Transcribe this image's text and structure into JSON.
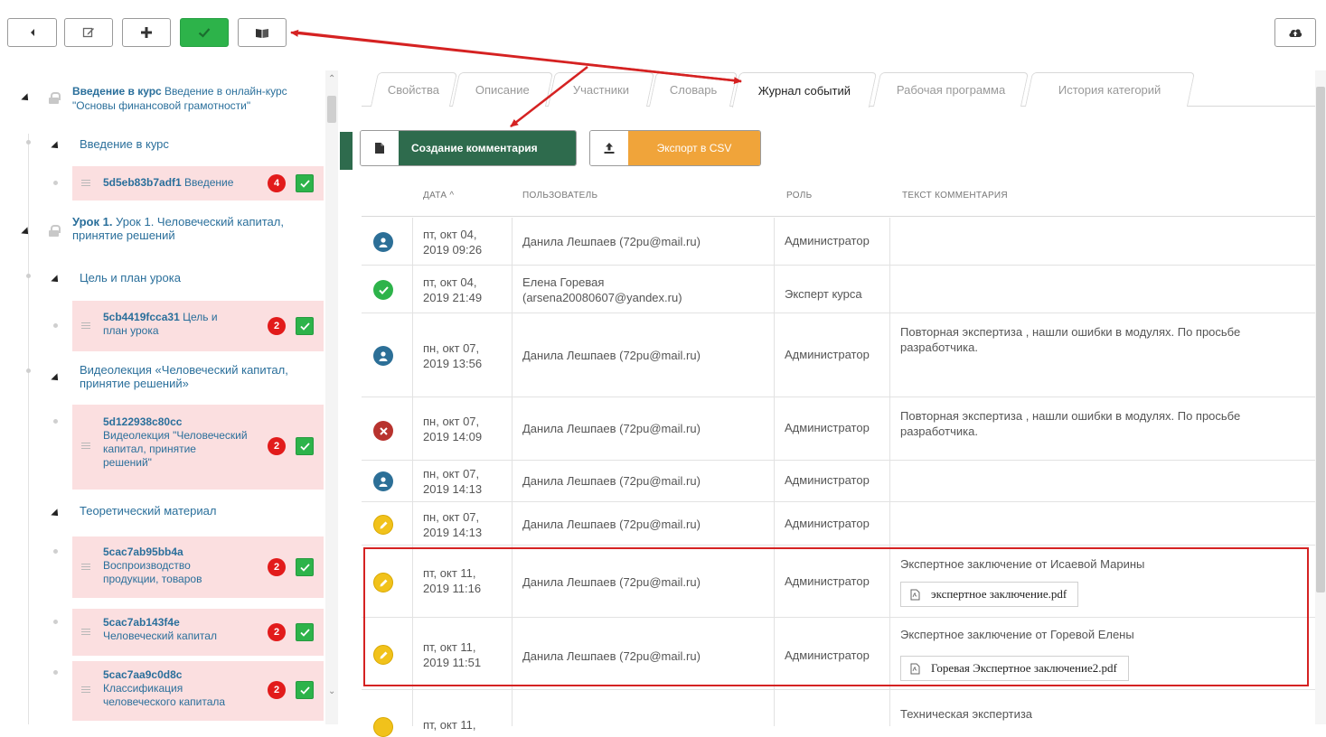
{
  "toolbar": {
    "buttons": [
      {
        "name": "back-button",
        "icon": "caret-left-icon"
      },
      {
        "name": "edit-button",
        "icon": "edit-icon"
      },
      {
        "name": "add-button",
        "icon": "plus-icon"
      },
      {
        "name": "approve-button",
        "icon": "check-icon"
      },
      {
        "name": "book-button",
        "icon": "book-icon"
      }
    ],
    "upload_icon": "cloud-upload-icon"
  },
  "sidebar": {
    "nodes": [
      {
        "bold": "Введение в курс",
        "text": " Введение в онлайн-курс \"Основы финансовой грамотности\""
      },
      {
        "text": "Введение в курс"
      },
      {
        "code": "5d5eb83b7adf1",
        "text": " Введение",
        "badge": "4"
      },
      {
        "bold": "Урок 1.",
        "text": " Урок 1. Человеческий капитал, принятие решений"
      },
      {
        "text": "Цель и план урока"
      },
      {
        "code": "5cb4419fcca31",
        "text": " Цель и план урока",
        "badge": "2"
      },
      {
        "text": "Видеолекция «Человеческий капитал, принятие решений»"
      },
      {
        "code": "5d122938c80cc",
        "text": "Видеолекция \"Человеческий капитал, принятие решений\"",
        "badge": "2"
      },
      {
        "text": "Теоретический материал"
      },
      {
        "code": "5cac7ab95bb4a",
        "text": "Воспроизводство продукции, товаров",
        "badge": "2"
      },
      {
        "code": "5cac7ab143f4e",
        "text": "Человеческий капитал",
        "badge": "2"
      },
      {
        "code": "5cac7aa9c0d8c",
        "text": "Классификация человеческого капитала",
        "badge": "2"
      }
    ]
  },
  "tabs": [
    "Свойства",
    "Описание",
    "Участники",
    "Словарь",
    "Журнал событий",
    "Рабочая программа",
    "История категорий"
  ],
  "active_tab": "Журнал событий",
  "actions": {
    "create_comment": "Создание комментария",
    "export_csv": "Экспорт в CSV"
  },
  "table": {
    "headers": {
      "date": "ДАТА ^",
      "user": "ПОЛЬЗОВАТЕЛЬ",
      "role": "РОЛЬ",
      "comment": "ТЕКСТ КОММЕНТАРИЯ"
    },
    "rows": [
      {
        "status": "person-icon",
        "date1": "пт, окт 04,",
        "date2": "2019 09:26",
        "user1": "Данила Лешпаев (72pu@mail.ru)",
        "user2": "",
        "role": "Администратор",
        "comment": ""
      },
      {
        "status": "check-icon",
        "date1": "пт, окт 04,",
        "date2": "2019 21:49",
        "user1": "Елена Горевая",
        "user2": "(arsena20080607@yandex.ru)",
        "role": "Эксперт курса",
        "comment": ""
      },
      {
        "status": "person-icon",
        "date1": "пн, окт 07,",
        "date2": "2019 13:56",
        "user1": "Данила Лешпаев (72pu@mail.ru)",
        "user2": "",
        "role": "Администратор",
        "comment": "Повторная экспертиза , нашли ошибки в модулях. По просьбе разработчика."
      },
      {
        "status": "error-icon",
        "date1": "пн, окт 07,",
        "date2": "2019 14:09",
        "user1": "Данила Лешпаев (72pu@mail.ru)",
        "user2": "",
        "role": "Администратор",
        "comment": "Повторная экспертиза , нашли ошибки в модулях. По просьбе разработчика."
      },
      {
        "status": "person-icon",
        "date1": "пн, окт 07,",
        "date2": "2019 14:13",
        "user1": "Данила Лешпаев (72pu@mail.ru)",
        "user2": "",
        "role": "Администратор",
        "comment": ""
      },
      {
        "status": "edit-icon",
        "date1": "пн, окт 07,",
        "date2": "2019 14:13",
        "user1": "Данила Лешпаев (72pu@mail.ru)",
        "user2": "",
        "role": "Администратор",
        "comment": ""
      },
      {
        "status": "edit-icon",
        "date1": "пт, окт 11,",
        "date2": "2019 11:16",
        "user1": "Данила Лешпаев (72pu@mail.ru)",
        "user2": "",
        "role": "Администратор",
        "comment": "Экспертное заключение от Исаевой Марины",
        "file": "экспертное заключение.pdf"
      },
      {
        "status": "edit-icon",
        "date1": "пт, окт 11,",
        "date2": "2019 11:51",
        "user1": "Данила Лешпаев (72pu@mail.ru)",
        "user2": "",
        "role": "Администратор",
        "comment": "Экспертное заключение от Горевой Елены",
        "file": "Горевая Экспертное заключение2.pdf"
      },
      {
        "status": "edit-icon",
        "date1": "пт, окт 11,",
        "date2": "",
        "user1": "",
        "user2": "",
        "role": "",
        "comment": "Техническая экспертиза"
      }
    ]
  },
  "colors": {
    "green": "#2db34a",
    "dark_green": "#2e6b4d",
    "orange": "#f0a43a",
    "link_blue": "#2a6f9b",
    "pink_item": "#fbdfe0",
    "badge_red": "#e21b1b",
    "highlight_red": "#d52222"
  }
}
